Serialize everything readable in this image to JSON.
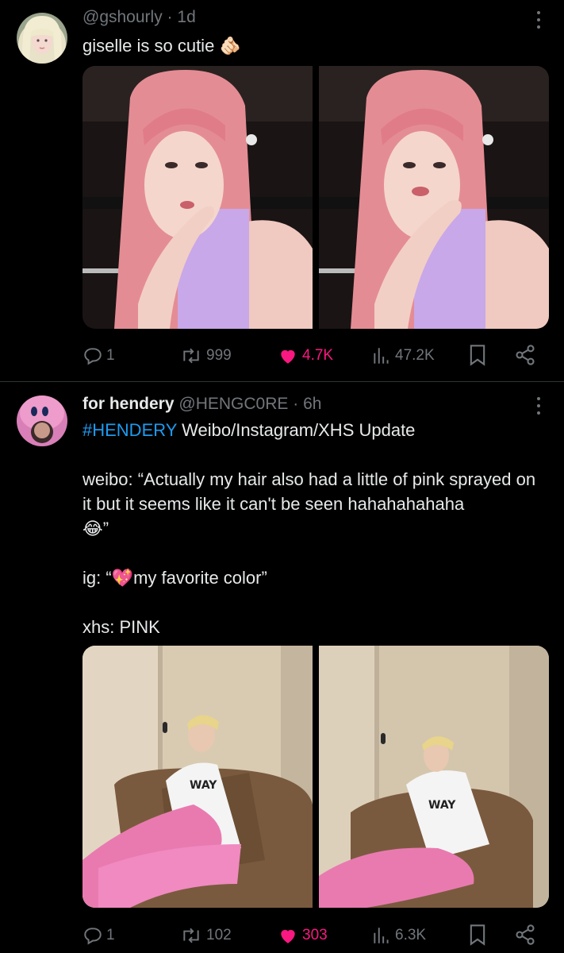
{
  "posts": [
    {
      "display_name": "",
      "handle": "@gshourly",
      "separator": "·",
      "time": "1d",
      "text": "giselle is so cutie",
      "emoji": "🫵🏻",
      "stats": {
        "replies": "1",
        "reposts": "999",
        "likes": "4.7K",
        "views": "47.2K"
      }
    },
    {
      "display_name": "for hendery",
      "handle": "@HENGC0RE",
      "separator": "·",
      "time": "6h",
      "hashtag": "#HENDERY",
      "text_line1_rest": " Weibo/Instagram/XHS Update",
      "weibo": "weibo: “Actually my hair also had a little of pink sprayed on it but it seems like it can't be seen hahahahahaha",
      "weibo_emoji": "😂",
      "weibo_end": "”",
      "ig_prefix": "ig: “",
      "ig_emoji": "💖",
      "ig_text": "my favorite color”",
      "xhs": "xhs: PINK",
      "stats": {
        "replies": "1",
        "reposts": "102",
        "likes": "303",
        "views": "6.3K"
      }
    }
  ],
  "colors": {
    "like": "#f91880",
    "hashtag": "#1d9bf0",
    "muted": "#71767b",
    "text": "#e7e9ea"
  },
  "icons": [
    "reply-icon",
    "repost-icon",
    "like-icon",
    "views-icon",
    "bookmark-icon",
    "share-icon",
    "more-icon"
  ]
}
